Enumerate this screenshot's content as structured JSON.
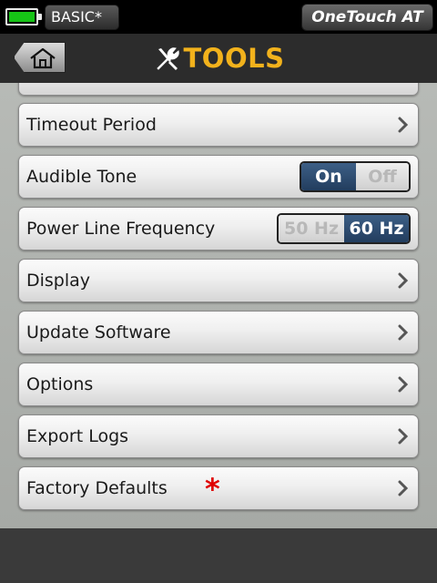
{
  "status": {
    "battery_icon": "battery-full-icon",
    "battery_color": "#16c416",
    "profile": "BASIC*",
    "device": "OneTouch AT"
  },
  "header": {
    "home_icon": "home-icon",
    "title_icon": "tools-icon",
    "title": "TOOLS",
    "title_color": "#f2b21c"
  },
  "settings": {
    "timeout_period": "Timeout Period",
    "audible_tone": {
      "label": "Audible Tone",
      "on_label": "On",
      "off_label": "Off",
      "selected": "On"
    },
    "power_line_frequency": {
      "label": "Power Line Frequency",
      "opt_50": "50 Hz",
      "opt_60": "60 Hz",
      "selected": "60 Hz"
    },
    "display": "Display",
    "update_software": "Update Software",
    "options": "Options",
    "export_logs": "Export Logs",
    "factory_defaults": {
      "label": "Factory Defaults",
      "marker": "*"
    }
  },
  "colors": {
    "toggle_selected": "#2a4a70",
    "marker": "#e00000"
  }
}
